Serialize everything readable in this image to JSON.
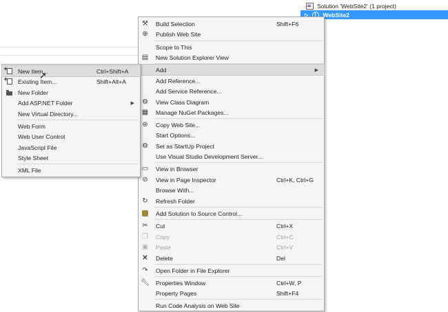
{
  "solution_explorer": {
    "solution_label": "Solution 'WebSite2' (1 project)",
    "project_label": "WebSite2",
    "colors": {
      "selection": "#3399ff"
    }
  },
  "context_menu": {
    "items": [
      {
        "label": "Build Selection",
        "shortcut": "Shift+F6",
        "icon": "build-icon"
      },
      {
        "label": "Publish Web Site",
        "shortcut": "",
        "icon": "publish-icon"
      },
      {
        "label": "Scope to This",
        "shortcut": "",
        "icon": ""
      },
      {
        "label": "New Solution Explorer View",
        "shortcut": "",
        "icon": "new-view-icon"
      },
      {
        "label": "Add",
        "shortcut": "",
        "icon": ""
      },
      {
        "label": "Add Reference...",
        "shortcut": "",
        "icon": ""
      },
      {
        "label": "Add Service Reference...",
        "shortcut": "",
        "icon": ""
      },
      {
        "label": "View Class Diagram",
        "shortcut": "",
        "icon": "class-diagram-icon"
      },
      {
        "label": "Manage NuGet Packages...",
        "shortcut": "",
        "icon": "nuget-icon"
      },
      {
        "label": "Copy Web Site...",
        "shortcut": "",
        "icon": "copy-web-site-icon"
      },
      {
        "label": "Start Options...",
        "shortcut": "",
        "icon": ""
      },
      {
        "label": "Set as StartUp Project",
        "shortcut": "",
        "icon": "gear-icon"
      },
      {
        "label": "Use Visual Studio Development Server...",
        "shortcut": "",
        "icon": ""
      },
      {
        "label": "View in Browser",
        "shortcut": "",
        "icon": "browser-icon"
      },
      {
        "label": "View in Page Inspector",
        "shortcut": "Ctrl+K, Ctrl+G",
        "icon": "page-inspector-icon"
      },
      {
        "label": "Browse With...",
        "shortcut": "",
        "icon": ""
      },
      {
        "label": "Refresh Folder",
        "shortcut": "",
        "icon": "refresh-icon"
      },
      {
        "label": "Add Solution to Source Control...",
        "shortcut": "",
        "icon": "source-control-icon"
      },
      {
        "label": "Cut",
        "shortcut": "Ctrl+X",
        "icon": "scissors-icon"
      },
      {
        "label": "Copy",
        "shortcut": "Ctrl+C",
        "icon": "copy-icon",
        "disabled": true
      },
      {
        "label": "Paste",
        "shortcut": "Ctrl+V",
        "icon": "paste-icon",
        "disabled": true
      },
      {
        "label": "Delete",
        "shortcut": "Del",
        "icon": "delete-icon"
      },
      {
        "label": "Open Folder in File Explorer",
        "shortcut": "",
        "icon": "open-folder-icon"
      },
      {
        "label": "Properties Window",
        "shortcut": "Ctrl+W, P",
        "icon": "wrench-icon"
      },
      {
        "label": "Property Pages",
        "shortcut": "Shift+F4",
        "icon": ""
      },
      {
        "label": "Run Code Analysis on Web Site",
        "shortcut": "",
        "icon": ""
      }
    ]
  },
  "add_submenu": {
    "items": [
      {
        "label": "New Item...",
        "shortcut": "Ctrl+Shift+A",
        "icon": "new-item-icon"
      },
      {
        "label": "Existing Item...",
        "shortcut": "Shift+Alt+A",
        "icon": "existing-item-icon"
      },
      {
        "label": "New Folder",
        "shortcut": "",
        "icon": "new-folder-icon"
      },
      {
        "label": "Add ASP.NET Folder",
        "shortcut": "",
        "icon": ""
      },
      {
        "label": "New Virtual Directory...",
        "shortcut": "",
        "icon": ""
      },
      {
        "label": "Web Form",
        "shortcut": "",
        "icon": ""
      },
      {
        "label": "Web User Control",
        "shortcut": "",
        "icon": ""
      },
      {
        "label": "JavaScript File",
        "shortcut": "",
        "icon": ""
      },
      {
        "label": "Style Sheet",
        "shortcut": "",
        "icon": ""
      },
      {
        "label": "XML File",
        "shortcut": "",
        "icon": ""
      }
    ]
  }
}
